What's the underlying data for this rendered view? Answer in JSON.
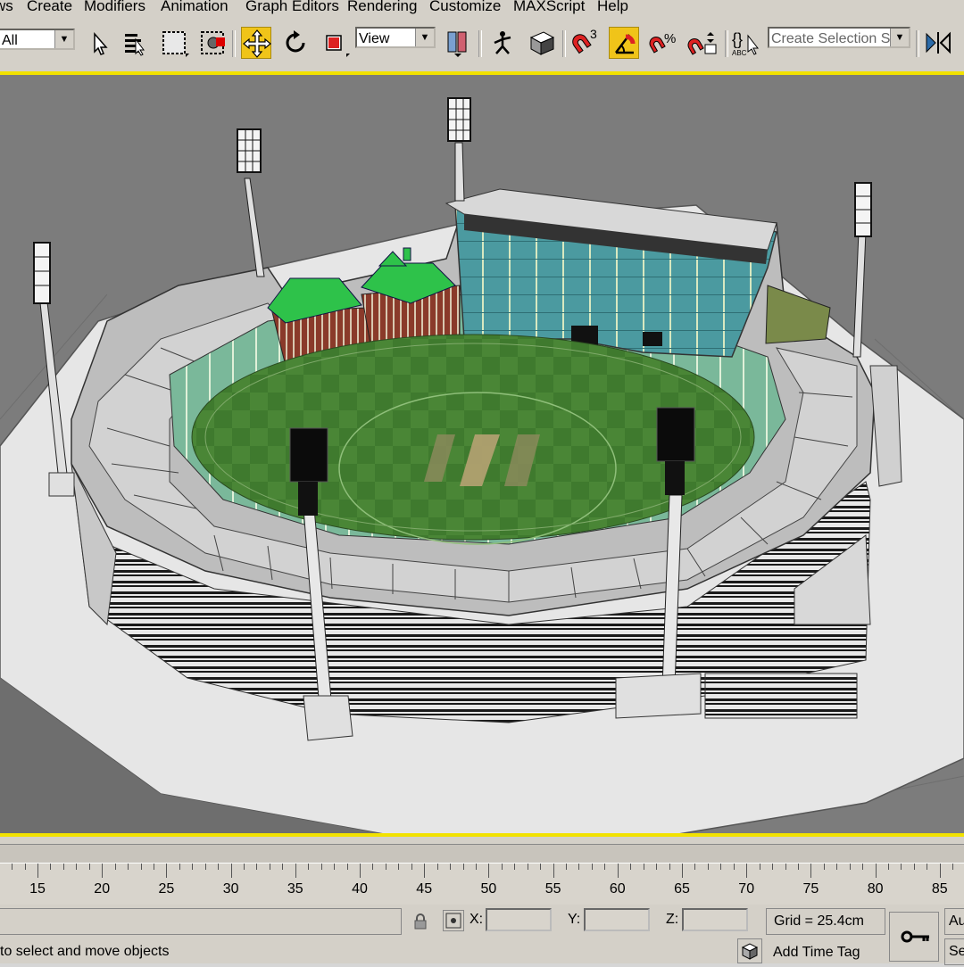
{
  "menu": {
    "items": [
      "ws",
      "Create",
      "Modifiers",
      "Animation",
      "Graph Editors",
      "Rendering",
      "Customize",
      "MAXScript",
      "Help"
    ]
  },
  "toolbar": {
    "selection_filter": "All",
    "reference_coord": "View",
    "named_selection_placeholder": "Create Selection Set",
    "snap_superscript": "3",
    "percent_snap": "%"
  },
  "timeline": {
    "ticks": [
      "15",
      "20",
      "25",
      "30",
      "35",
      "40",
      "45",
      "50",
      "55",
      "60",
      "65",
      "70",
      "75",
      "80",
      "85"
    ]
  },
  "status": {
    "x_label": "X:",
    "y_label": "Y:",
    "z_label": "Z:",
    "grid": "Grid = 25.4cm",
    "prompt": "to select and move objects",
    "add_time_tag": "Add Time Tag",
    "auto_key_partial": "Au",
    "set_key_partial": "Se"
  },
  "colors": {
    "active_button": "#f0c419",
    "viewport_border": "#f2e200",
    "viewport_bg": "#7c7c7c"
  }
}
